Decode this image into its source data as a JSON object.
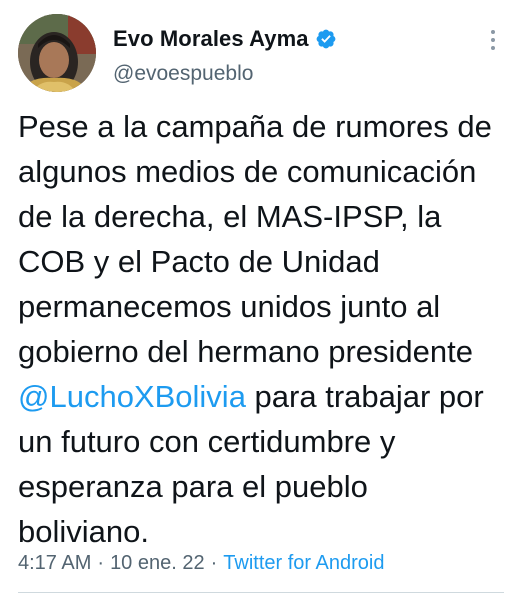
{
  "author": {
    "display_name": "Evo Morales Ayma",
    "handle": "@evoespueblo",
    "verified_color": "#1d9bf0",
    "avatar_icon": "profile-photo"
  },
  "tweet": {
    "text_before_mention": "Pese a la campaña de rumores de algunos medios de comunicación de la derecha, el MAS-IPSP, la COB y el Pacto de Unidad permanecemos unidos junto al gobierno del hermano presidente ",
    "mention": "@LuchoXBolivia",
    "text_after_mention": " para trabajar por un futuro con certidumbre y esperanza para el pueblo boliviano."
  },
  "meta": {
    "time": "4:17 AM",
    "separator": "·",
    "date": "10 ene. 22",
    "source": "Twitter for Android"
  },
  "colors": {
    "link": "#1d9bf0",
    "secondary_text": "#536471",
    "primary_text": "#0f1419"
  }
}
